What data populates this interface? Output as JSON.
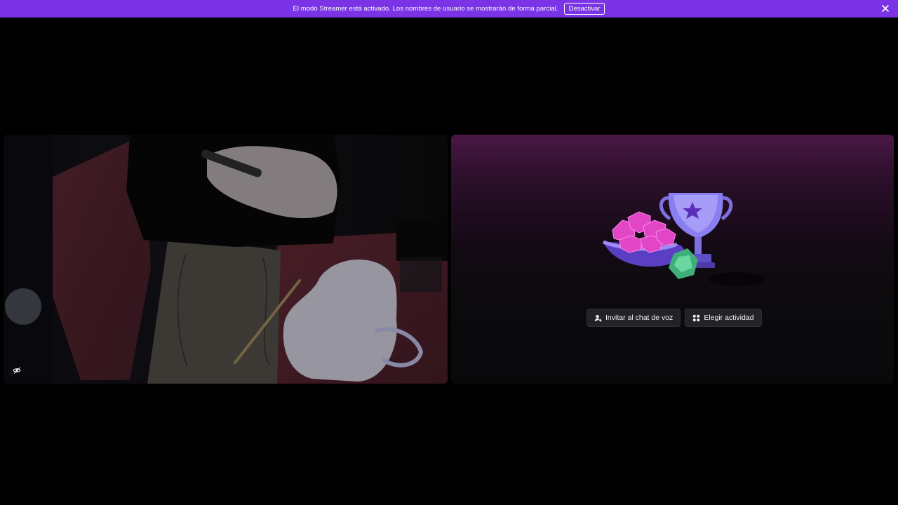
{
  "banner": {
    "message": "El modo Streamer está activado. Los nombres de usuario se mostrarán de forma parcial.",
    "deactivate_label": "Desactivar",
    "background": "#7a34e6"
  },
  "video_tile": {
    "status_icon": "no-camera-preview-icon"
  },
  "activity_tile": {
    "illustration": "trophy-gems-dice-illustration",
    "invite_label": "Invitar al chat de voz",
    "invite_icon": "person-add-icon",
    "activity_label": "Elegir actividad",
    "activity_icon": "apps-grid-icon"
  }
}
